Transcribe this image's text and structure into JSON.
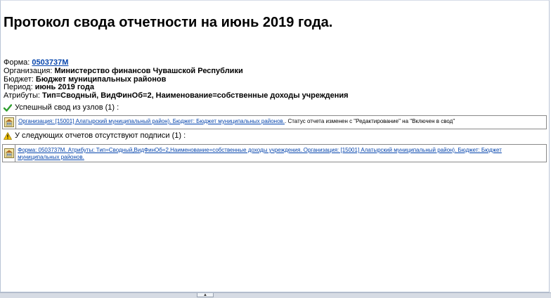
{
  "title": "Протокол свода отчетности на июнь 2019 года.",
  "info": {
    "form_label": "Форма:",
    "form_value": "0503737М",
    "org_label": "Организация:",
    "org_value": "Министерство финансов Чувашской Республики",
    "budget_label": "Бюджет:",
    "budget_value": "Бюджет муниципальных районов",
    "period_label": "Период:",
    "period_value": "июнь 2019 года",
    "attrs_label": "Атрибуты:",
    "attrs_value": "Тип=Сводный, ВидФинОб=2, Наименование=собственные доходы учреждения"
  },
  "sections": {
    "success": {
      "heading": "Успешный свод из узлов (1) :",
      "item_link": "Организация: [15001] Алатырский муниципальный район). Бюджет: Бюджет муниципальных районов.",
      "item_text": ". Статус отчета изменен с \"Редактирование\" на \"Включен в свод\""
    },
    "warning": {
      "heading": "У следующих отчетов отсутствуют подписи (1) :",
      "item_link": "Форма: 0503737М. Атрибуты: Тип=Сводный,ВидФинОб=2,Наименование=собственные доходы учреждения. Организация: [15001] Алатырский муниципальный район). Бюджет: Бюджет муниципальных районов."
    }
  },
  "colors": {
    "link": "#0645ad",
    "success_icon": "#2f9e2f",
    "warning_icon": "#f2c200"
  },
  "icons": {
    "success": "check-icon",
    "warning": "warning-icon",
    "item": "building-icon",
    "splitter": "chevron-up-icon"
  }
}
